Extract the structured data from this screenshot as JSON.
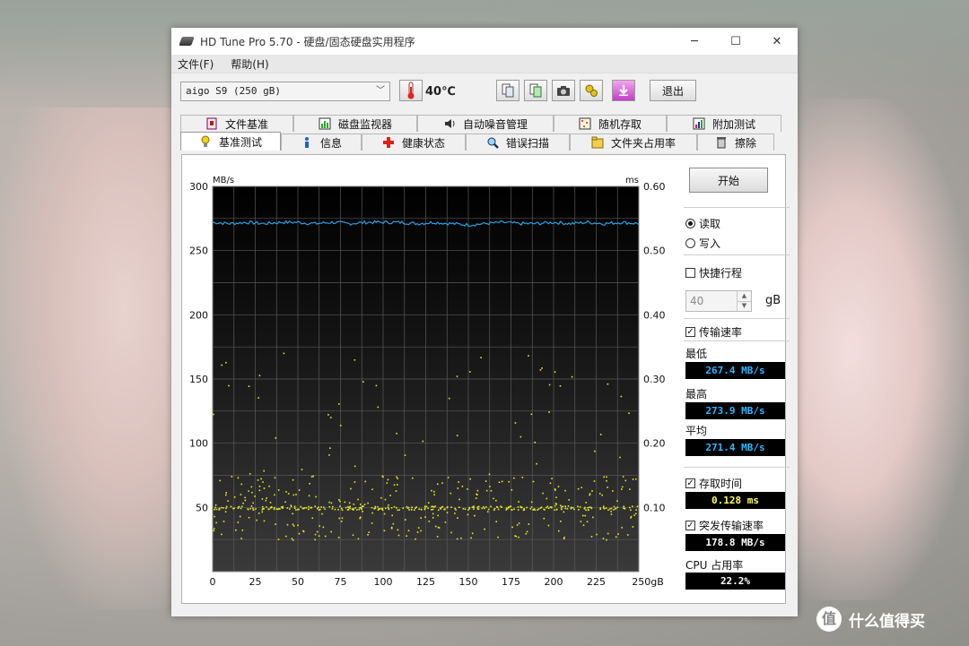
{
  "window": {
    "title": "HD Tune Pro 5.70 - 硬盘/固态硬盘实用程序",
    "controls": {
      "minimize": "─",
      "maximize": "☐",
      "close": "✕"
    }
  },
  "menu": [
    "文件(F)",
    "帮助(H)"
  ],
  "toolbar": {
    "drive": "aigo    S9 (250 gB)",
    "temperature": "40℃",
    "exit": "退出",
    "icons": [
      "copy-info-icon",
      "copy-screenshot-icon",
      "camera-icon",
      "options-icon",
      "download-icon"
    ]
  },
  "tabs_back": [
    {
      "label": "文件基准",
      "icon": "file-benchmark-icon"
    },
    {
      "label": "磁盘监视器",
      "icon": "disk-monitor-icon"
    },
    {
      "label": "自动噪音管理",
      "icon": "speaker-icon"
    },
    {
      "label": "随机存取",
      "icon": "random-access-icon"
    },
    {
      "label": "附加测试",
      "icon": "extra-tests-icon"
    }
  ],
  "tabs_front": [
    {
      "label": "基准测试",
      "icon": "benchmark-icon",
      "active": true
    },
    {
      "label": "信息",
      "icon": "info-icon"
    },
    {
      "label": "健康状态",
      "icon": "health-icon"
    },
    {
      "label": "错误扫描",
      "icon": "error-scan-icon"
    },
    {
      "label": "文件夹占用率",
      "icon": "folder-usage-icon"
    },
    {
      "label": "擦除",
      "icon": "erase-icon"
    }
  ],
  "side": {
    "start": "开始",
    "read": "读取",
    "write": "写入",
    "short_stroke": "快捷行程",
    "short_stroke_value": "40",
    "short_stroke_unit": "gB",
    "transfer_rate": "传输速率",
    "min_label": "最低",
    "min_value": "267.4 MB/s",
    "max_label": "最高",
    "max_value": "273.9 MB/s",
    "avg_label": "平均",
    "avg_value": "271.4 MB/s",
    "access_time": "存取时间",
    "access_value": "0.128 ms",
    "burst": "突发传输速率",
    "burst_value": "178.8 MB/s",
    "cpu_label": "CPU 占用率",
    "cpu_value": "22.2%"
  },
  "chart_data": {
    "type": "line",
    "y_left_label": "MB/s",
    "y_right_label": "ms",
    "x_unit": "gB",
    "xlim": [
      0,
      250
    ],
    "ylim_left": [
      0,
      300
    ],
    "ylim_right": [
      0,
      0.6
    ],
    "x_ticks": [
      0,
      25,
      50,
      75,
      100,
      125,
      150,
      175,
      200,
      225,
      250
    ],
    "x_tick_labels": [
      "0",
      "25",
      "50",
      "75",
      "100",
      "125",
      "150",
      "175",
      "200",
      "225",
      "250gB"
    ],
    "y_left_ticks": [
      50,
      100,
      150,
      200,
      250,
      300
    ],
    "y_right_ticks": [
      "0.10",
      "0.20",
      "0.30",
      "0.40",
      "0.50",
      "0.60"
    ],
    "transfer_rate_series": {
      "x": [
        0,
        10,
        20,
        30,
        40,
        50,
        60,
        70,
        80,
        90,
        100,
        110,
        120,
        130,
        140,
        150,
        160,
        170,
        180,
        190,
        200,
        210,
        220,
        230,
        240,
        250
      ],
      "values": [
        272,
        271,
        272,
        271,
        272,
        272,
        271,
        272,
        271,
        272,
        272,
        272,
        271,
        272,
        271,
        270,
        271,
        272,
        271,
        271,
        272,
        271,
        272,
        271,
        272,
        271
      ]
    },
    "access_time_series": {
      "baseline_ms": 0.1,
      "spread_ms": [
        0.05,
        0.35
      ],
      "points": 600
    },
    "colors": {
      "transfer": "#2aa0e0",
      "access": "#e8e82a"
    }
  }
}
